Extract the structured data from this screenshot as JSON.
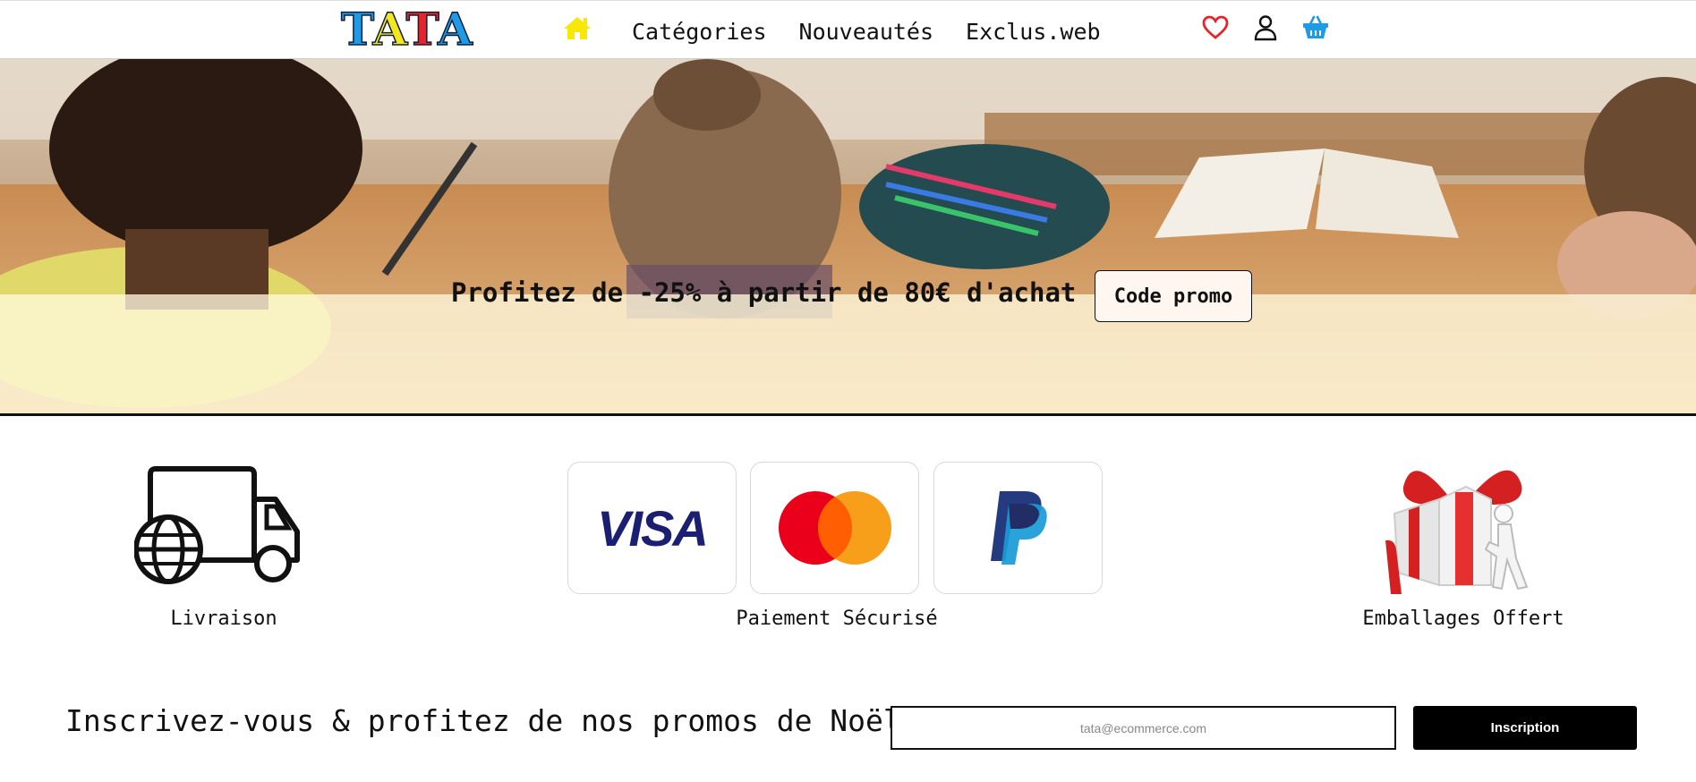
{
  "nav": {
    "logo_letters": [
      "T",
      "A",
      "T",
      "A"
    ],
    "logo_colors": [
      "#1e9be4",
      "#f4e81c",
      "#e8242b",
      "#1e9be4"
    ],
    "home_icon": "home-icon",
    "links": [
      "Catégories",
      "Nouveautés",
      "Exclus.web"
    ],
    "icons": [
      "heart-icon",
      "user-icon",
      "basket-icon"
    ],
    "colors": {
      "home": "#f7e80a",
      "heart": "#e8242b",
      "basket": "#1e9be4"
    }
  },
  "hero": {
    "promo_text": "Profitez de -25% à partir de 80€ d'achat",
    "promo_button": "Code promo"
  },
  "features": {
    "delivery_label": "Livraison",
    "payment_label": "Paiement Sécurisé",
    "payment_methods": [
      "VISA",
      "Mastercard",
      "PayPal"
    ],
    "gift_label": "Emballages Offert"
  },
  "newsletter": {
    "title": "Inscrivez-vous & profitez de nos promos de Noël",
    "email_placeholder": "tata@ecommerce.com",
    "button": "Inscription"
  }
}
